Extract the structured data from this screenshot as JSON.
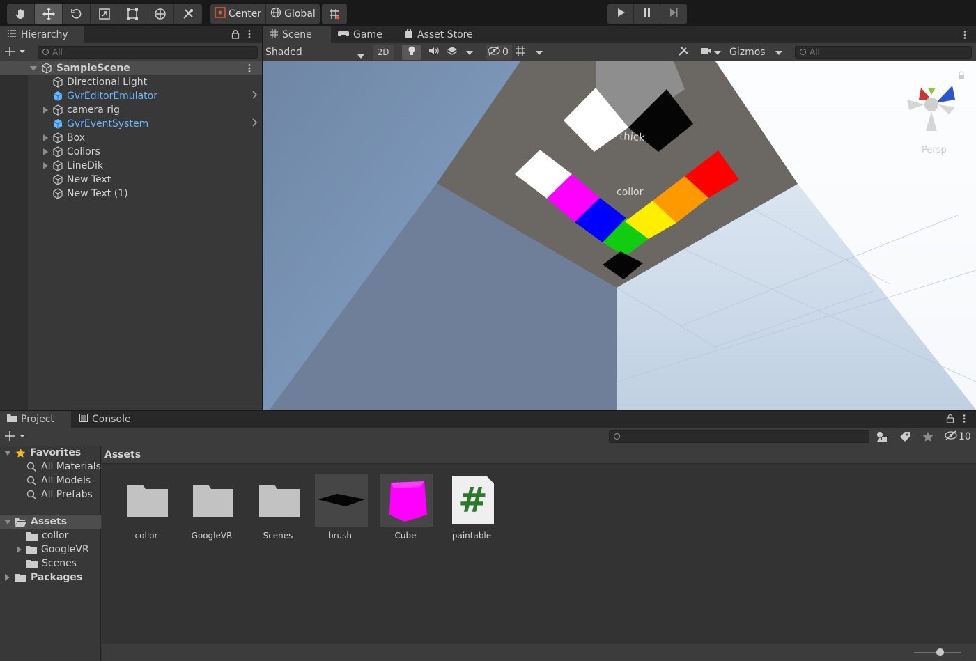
{
  "toolbar": {
    "tools": [
      "hand-icon",
      "move-icon",
      "rotate-icon",
      "scale-icon",
      "rect-tool-icon",
      "transform-icon",
      "custom-tool-icon"
    ],
    "pivot_label": "Center",
    "space_label": "Global",
    "snap_icon": "grid-snap-icon"
  },
  "hierarchy": {
    "tab_label": "Hierarchy",
    "search_placeholder": "All",
    "scene_name": "SampleScene",
    "items": [
      {
        "label": "Directional Light",
        "prefab": false,
        "expandable": false
      },
      {
        "label": "GvrEditorEmulator",
        "prefab": true,
        "expandable": false
      },
      {
        "label": "camera rig",
        "prefab": false,
        "expandable": true
      },
      {
        "label": "GvrEventSystem",
        "prefab": true,
        "expandable": false
      },
      {
        "label": "Box",
        "prefab": false,
        "expandable": true
      },
      {
        "label": "Collors",
        "prefab": false,
        "expandable": true
      },
      {
        "label": "LineDik",
        "prefab": false,
        "expandable": true
      },
      {
        "label": "New Text",
        "prefab": false,
        "expandable": false
      },
      {
        "label": "New Text (1)",
        "prefab": false,
        "expandable": false
      }
    ]
  },
  "scene": {
    "tabs": [
      "Scene",
      "Game",
      "Asset Store"
    ],
    "shading_mode": "Shaded",
    "mode_2d": "2D",
    "hidden_count": "0",
    "gizmos_label": "Gizmos",
    "search_placeholder": "All",
    "perspective_label": "Persp",
    "world_text": [
      "thick",
      "collor"
    ]
  },
  "project": {
    "tabs": [
      "Project",
      "Console"
    ],
    "hidden_count": "10",
    "breadcrumb": "Assets",
    "tree": {
      "favorites_label": "Favorites",
      "favorites": [
        "All Materials",
        "All Models",
        "All Prefabs"
      ],
      "assets_label": "Assets",
      "asset_folders": [
        "collor",
        "GoogleVR",
        "Scenes"
      ],
      "packages_label": "Packages"
    },
    "assets": [
      {
        "name": "collor",
        "kind": "folder"
      },
      {
        "name": "GoogleVR",
        "kind": "folder"
      },
      {
        "name": "Scenes",
        "kind": "folder"
      },
      {
        "name": "brush",
        "kind": "mesh"
      },
      {
        "name": "Cube",
        "kind": "prefab"
      },
      {
        "name": "paintable",
        "kind": "script",
        "glyph": "#"
      }
    ],
    "zoom_slider_value": 0.55
  },
  "colors": {
    "accent_blue": "#67b8ff",
    "magenta": "#ff00ff",
    "script_green": "#2b7a2b"
  }
}
